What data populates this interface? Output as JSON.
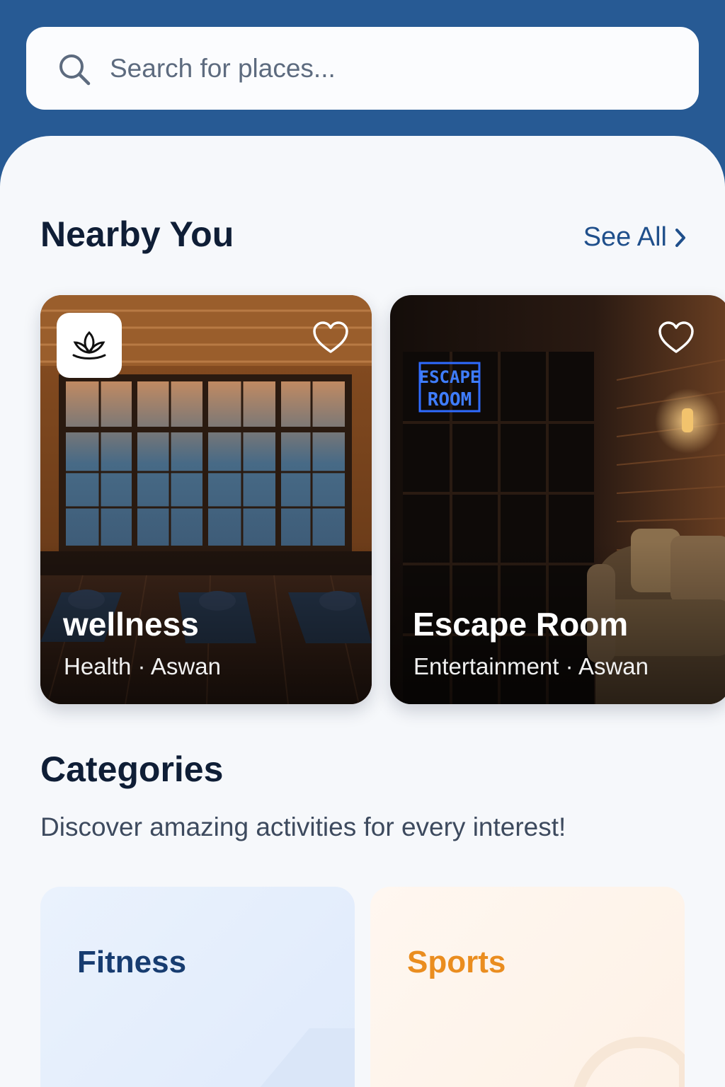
{
  "search": {
    "placeholder": "Search for places..."
  },
  "nearby": {
    "title": "Nearby You",
    "see_all": "See All",
    "cards": [
      {
        "name": "wellness",
        "meta": "Health · Aswan",
        "icon": "lotus-icon"
      },
      {
        "name": "Escape Room",
        "meta": "Entertainment · Aswan",
        "sign": [
          "ESCAPE",
          "ROOM"
        ]
      }
    ]
  },
  "categories": {
    "title": "Categories",
    "subtitle": "Discover amazing activities for every interest!",
    "items": [
      {
        "label": "Fitness",
        "color": "#173c70"
      },
      {
        "label": "Sports",
        "color": "#ea8d1f"
      }
    ]
  },
  "colors": {
    "header": "#275a94",
    "accent": "#1f4f8b",
    "title": "#0f1e36"
  }
}
